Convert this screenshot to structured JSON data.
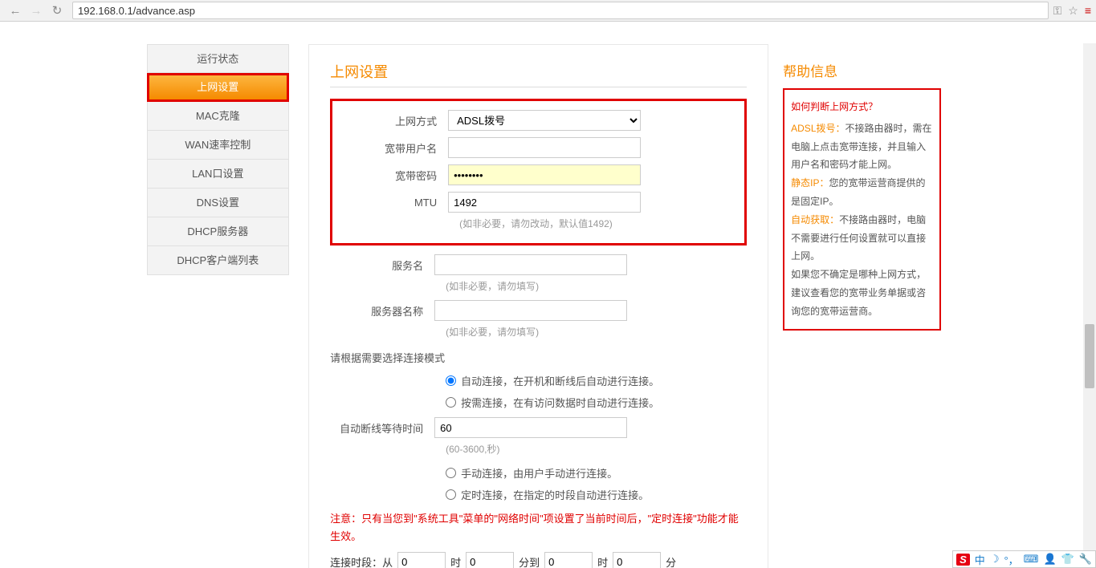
{
  "browser": {
    "url": "192.168.0.1/advance.asp"
  },
  "sidebar": {
    "items": [
      {
        "label": "运行状态"
      },
      {
        "label": "上网设置"
      },
      {
        "label": "MAC克隆"
      },
      {
        "label": "WAN速率控制"
      },
      {
        "label": "LAN口设置"
      },
      {
        "label": "DNS设置"
      },
      {
        "label": "DHCP服务器"
      },
      {
        "label": "DHCP客户端列表"
      }
    ]
  },
  "main": {
    "title": "上网设置",
    "conn_type_label": "上网方式",
    "conn_type_value": "ADSL拨号",
    "user_label": "宽带用户名",
    "user_value": "",
    "pw_label": "宽带密码",
    "pw_value": "••••••••",
    "mtu_label": "MTU",
    "mtu_value": "1492",
    "mtu_hint": "(如非必要，请勿改动，默认值1492)",
    "service_label": "服务名",
    "service_value": "",
    "service_hint": "(如非必要，请勿填写)",
    "server_label": "服务器名称",
    "server_value": "",
    "server_hint": "(如非必要，请勿填写)",
    "section1": "请根据需要选择连接模式",
    "radio_auto": "自动连接，在开机和断线后自动进行连接。",
    "radio_demand": "按需连接，在有访问数据时自动进行连接。",
    "idle_label": "自动断线等待时间",
    "idle_value": "60",
    "idle_hint": "(60-3600,秒)",
    "radio_manual": "手动连接，由用户手动进行连接。",
    "radio_timed": "定时连接，在指定的时段自动进行连接。",
    "notice": "注意：只有当您到\"系统工具\"菜单的\"网络时间\"项设置了当前时间后，\"定时连接\"功能才能生效。",
    "time_prefix": "连接时段：从",
    "time_h1": "0",
    "time_hl": "时",
    "time_m1": "0",
    "time_to": "分到",
    "time_h2": "0",
    "time_m2": "0",
    "time_suffix": "分"
  },
  "help": {
    "title": "帮助信息",
    "q": "如何判断上网方式？",
    "adsl_k": "ADSL拨号：",
    "adsl_t": "不接路由器时，需在电脑上点击宽带连接，并且输入用户名和密码才能上网。",
    "static_k": "静态IP：",
    "static_t": "您的宽带运营商提供的是固定IP。",
    "auto_k": "自动获取：",
    "auto_t": "不接路由器时，电脑不需要进行任何设置就可以直接上网。",
    "footer": "如果您不确定是哪种上网方式，建议查看您的宽带业务单据或咨询您的宽带运营商。"
  },
  "ime": {
    "cn": "中"
  }
}
